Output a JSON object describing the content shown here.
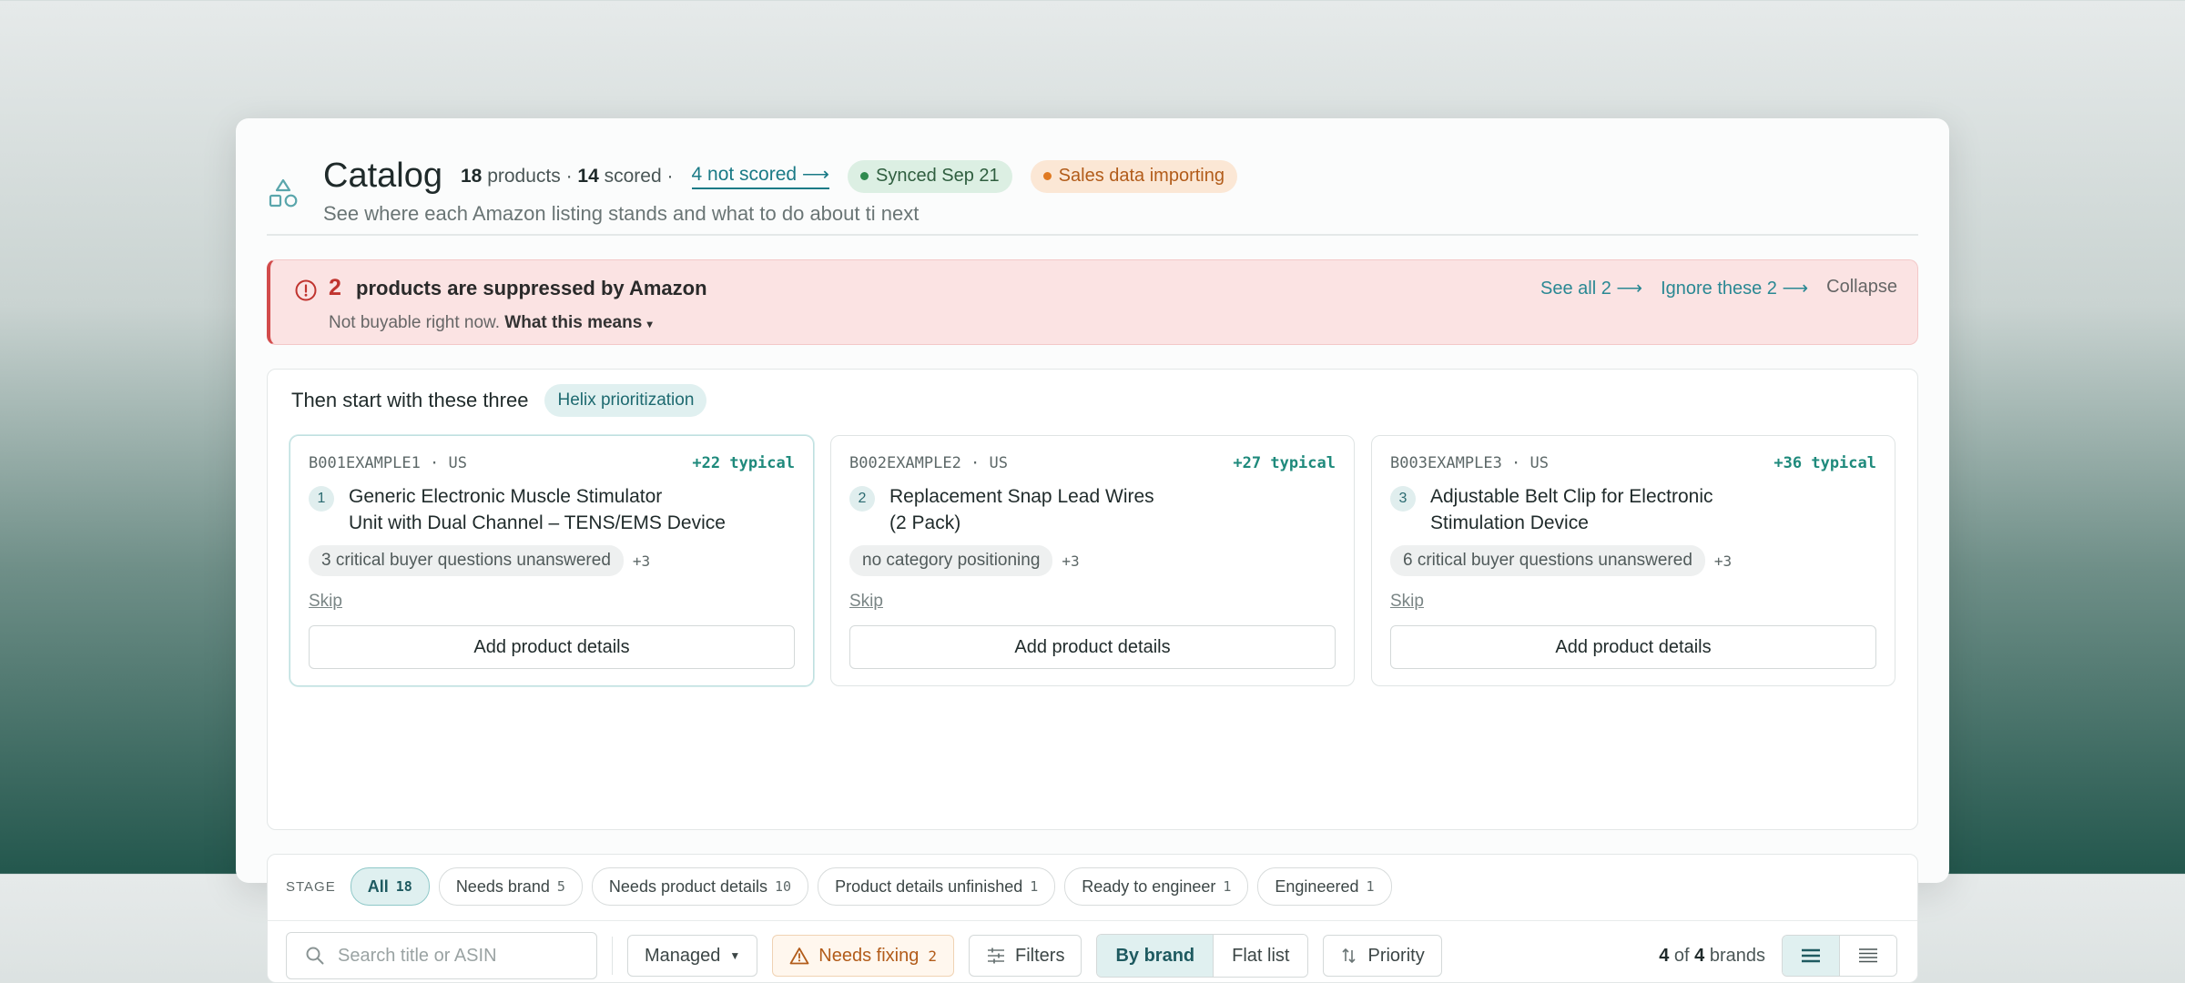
{
  "header": {
    "app_icon": "shapes-icon",
    "title": "Catalog",
    "products_count": "18",
    "products_label": "products",
    "separator": "·",
    "scored_count": "14",
    "scored_label": "scored",
    "not_scored_link": "4 not scored ⟶",
    "synced_pill": "Synced Sep 21",
    "importing_pill": "Sales data importing",
    "subtitle": "See where each Amazon listing stands and what to do about ti next",
    "colors": {
      "synced": "#2f8a4e",
      "importing": "#e07a22",
      "accent": "#1a7a86"
    }
  },
  "alert": {
    "icon": "alert-circle-icon",
    "count": "2",
    "title": "products are suppressed by Amazon",
    "sub_text": "Not buyable right now.",
    "what_this_means": "What this means",
    "see_all": "See all 2 ⟶",
    "ignore": "Ignore these 2 ⟶",
    "collapse": "Collapse",
    "colors": {
      "border": "#d24b4b",
      "background": "#fbe3e3"
    }
  },
  "prioritization": {
    "title": "Then start with these three",
    "badge": "Helix prioritization",
    "cards": [
      {
        "asin": "B001EXAMPLE1 · US",
        "typical": "+22 typical",
        "rank": "1",
        "title_line1": "Generic Electronic Muscle Stimulator",
        "title_line2": "Unit with Dual Channel – TENS/EMS Device",
        "tag": "3 critical buyer questions unanswered",
        "more": "+3",
        "skip": "Skip",
        "action": "Add product details"
      },
      {
        "asin": "B002EXAMPLE2 · US",
        "typical": "+27 typical",
        "rank": "2",
        "title_line1": "Replacement Snap Lead Wires",
        "title_line2": "(2 Pack)",
        "tag": "no category positioning",
        "more": "+3",
        "skip": "Skip",
        "action": "Add product details"
      },
      {
        "asin": "B003EXAMPLE3 · US",
        "typical": "+36 typical",
        "rank": "3",
        "title_line1": "Adjustable Belt Clip for Electronic",
        "title_line2": "Stimulation Device",
        "tag": "6 critical buyer questions unanswered",
        "more": "+3",
        "skip": "Skip",
        "action": "Add product details"
      }
    ]
  },
  "stages": {
    "label": "STAGE",
    "items": [
      {
        "label": "All",
        "count": "18",
        "active": true
      },
      {
        "label": "Needs brand",
        "count": "5"
      },
      {
        "label": "Needs product details",
        "count": "10"
      },
      {
        "label": "Product details unfinished",
        "count": "1"
      },
      {
        "label": "Ready to engineer",
        "count": "1"
      },
      {
        "label": "Engineered",
        "count": "1"
      }
    ]
  },
  "toolbar": {
    "search_placeholder": "Search title or ASIN",
    "managed": "Managed",
    "needs_fixing": "Needs fixing",
    "needs_fixing_count": "2",
    "filters": "Filters",
    "by_brand": "By brand",
    "flat_list": "Flat list",
    "priority": "Priority",
    "brand_shown": "4",
    "brand_of": "of",
    "brand_total": "4",
    "brand_label": "brands"
  }
}
